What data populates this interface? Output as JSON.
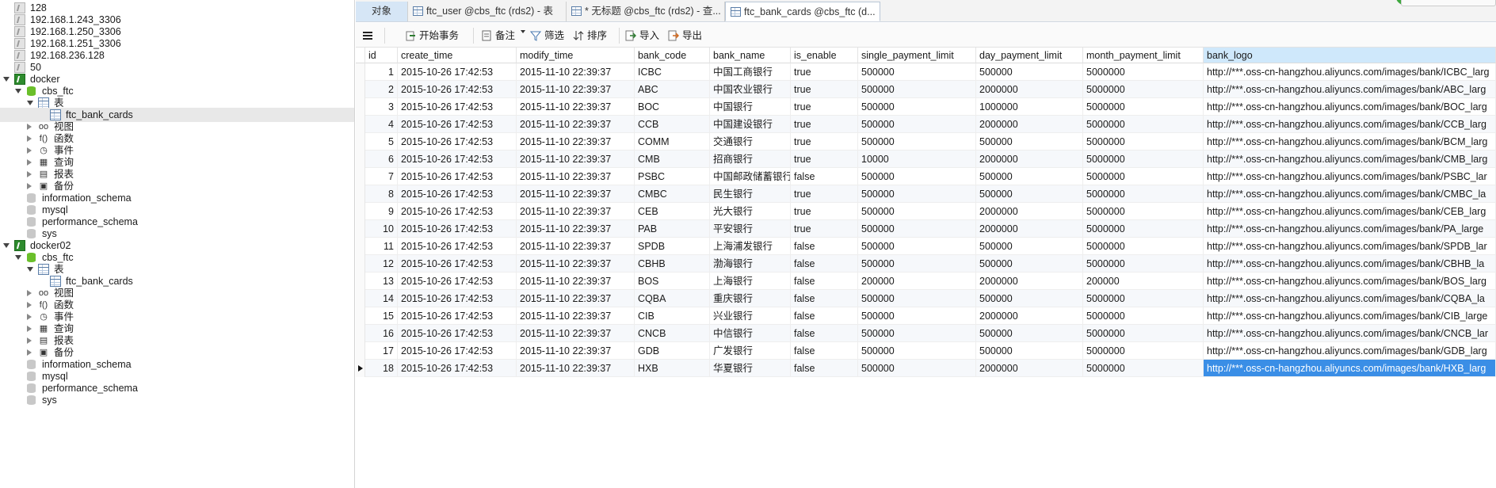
{
  "tree": [
    {
      "label": "128",
      "icon": "connection-gray-icon",
      "depth": 0,
      "tw": "none"
    },
    {
      "label": "192.168.1.243_3306",
      "icon": "connection-gray-icon",
      "depth": 0,
      "tw": "none"
    },
    {
      "label": "192.168.1.250_3306",
      "icon": "connection-gray-icon",
      "depth": 0,
      "tw": "none"
    },
    {
      "label": "192.168.1.251_3306",
      "icon": "connection-gray-icon",
      "depth": 0,
      "tw": "none"
    },
    {
      "label": "192.168.236.128",
      "icon": "connection-gray-icon",
      "depth": 0,
      "tw": "none"
    },
    {
      "label": "50",
      "icon": "connection-gray-icon",
      "depth": 0,
      "tw": "none"
    },
    {
      "label": "docker",
      "icon": "connection-green-icon",
      "depth": 0,
      "tw": "open"
    },
    {
      "label": "cbs_ftc",
      "icon": "database-green-icon",
      "depth": 1,
      "tw": "open"
    },
    {
      "label": "表",
      "icon": "table-group-icon",
      "depth": 2,
      "tw": "open"
    },
    {
      "label": "ftc_bank_cards",
      "icon": "table-icon",
      "depth": 3,
      "tw": "none",
      "selected": true
    },
    {
      "label": "视图",
      "icon": "view-icon",
      "depth": 2,
      "tw": "closed"
    },
    {
      "label": "函数",
      "icon": "function-icon",
      "depth": 2,
      "tw": "closed"
    },
    {
      "label": "事件",
      "icon": "event-icon",
      "depth": 2,
      "tw": "closed"
    },
    {
      "label": "查询",
      "icon": "query-icon",
      "depth": 2,
      "tw": "closed"
    },
    {
      "label": "报表",
      "icon": "report-icon",
      "depth": 2,
      "tw": "closed"
    },
    {
      "label": "备份",
      "icon": "backup-icon",
      "depth": 2,
      "tw": "closed"
    },
    {
      "label": "information_schema",
      "icon": "database-gray-icon",
      "depth": 1,
      "tw": "none"
    },
    {
      "label": "mysql",
      "icon": "database-gray-icon",
      "depth": 1,
      "tw": "none"
    },
    {
      "label": "performance_schema",
      "icon": "database-gray-icon",
      "depth": 1,
      "tw": "none"
    },
    {
      "label": "sys",
      "icon": "database-gray-icon",
      "depth": 1,
      "tw": "none"
    },
    {
      "label": "docker02",
      "icon": "connection-green-icon",
      "depth": 0,
      "tw": "open"
    },
    {
      "label": "cbs_ftc",
      "icon": "database-green-icon",
      "depth": 1,
      "tw": "open"
    },
    {
      "label": "表",
      "icon": "table-group-icon",
      "depth": 2,
      "tw": "open"
    },
    {
      "label": "ftc_bank_cards",
      "icon": "table-icon",
      "depth": 3,
      "tw": "none"
    },
    {
      "label": "视图",
      "icon": "view-icon",
      "depth": 2,
      "tw": "closed"
    },
    {
      "label": "函数",
      "icon": "function-icon",
      "depth": 2,
      "tw": "closed"
    },
    {
      "label": "事件",
      "icon": "event-icon",
      "depth": 2,
      "tw": "closed"
    },
    {
      "label": "查询",
      "icon": "query-icon",
      "depth": 2,
      "tw": "closed"
    },
    {
      "label": "报表",
      "icon": "report-icon",
      "depth": 2,
      "tw": "closed"
    },
    {
      "label": "备份",
      "icon": "backup-icon",
      "depth": 2,
      "tw": "closed"
    },
    {
      "label": "information_schema",
      "icon": "database-gray-icon",
      "depth": 1,
      "tw": "none"
    },
    {
      "label": "mysql",
      "icon": "database-gray-icon",
      "depth": 1,
      "tw": "none"
    },
    {
      "label": "performance_schema",
      "icon": "database-gray-icon",
      "depth": 1,
      "tw": "none"
    },
    {
      "label": "sys",
      "icon": "database-gray-icon",
      "depth": 1,
      "tw": "none"
    }
  ],
  "tabs": [
    {
      "label": "对象",
      "icon": "",
      "active": false
    },
    {
      "label": "ftc_user @cbs_ftc (rds2) - 表",
      "icon": "table-icon",
      "active": false
    },
    {
      "label": "* 无标题 @cbs_ftc (rds2) - 查...",
      "icon": "query-icon",
      "active": false
    },
    {
      "label": "ftc_bank_cards @cbs_ftc (d...",
      "icon": "table-icon",
      "active": true
    }
  ],
  "toolbar": {
    "menu_icon": "hamburger-menu-icon",
    "begin_tx": "开始事务",
    "memo": "备注",
    "filter": "筛选",
    "sort": "排序",
    "import": "导入",
    "export": "导出"
  },
  "grid": {
    "columns": [
      "id",
      "create_time",
      "modify_time",
      "bank_code",
      "bank_name",
      "is_enable",
      "single_payment_limit",
      "day_payment_limit",
      "month_payment_limit",
      "bank_logo"
    ],
    "highlighted_column": "bank_logo",
    "current_row": 18,
    "rows": [
      [
        "1",
        "2015-10-26 17:42:53",
        "2015-11-10 22:39:37",
        "ICBC",
        "中国工商银行",
        "true",
        "500000",
        "500000",
        "5000000",
        "http://***.oss-cn-hangzhou.aliyuncs.com/images/bank/ICBC_larg"
      ],
      [
        "2",
        "2015-10-26 17:42:53",
        "2015-11-10 22:39:37",
        "ABC",
        "中国农业银行",
        "true",
        "500000",
        "2000000",
        "5000000",
        "http://***.oss-cn-hangzhou.aliyuncs.com/images/bank/ABC_larg"
      ],
      [
        "3",
        "2015-10-26 17:42:53",
        "2015-11-10 22:39:37",
        "BOC",
        "中国银行",
        "true",
        "500000",
        "1000000",
        "5000000",
        "http://***.oss-cn-hangzhou.aliyuncs.com/images/bank/BOC_larg"
      ],
      [
        "4",
        "2015-10-26 17:42:53",
        "2015-11-10 22:39:37",
        "CCB",
        "中国建设银行",
        "true",
        "500000",
        "2000000",
        "5000000",
        "http://***.oss-cn-hangzhou.aliyuncs.com/images/bank/CCB_larg"
      ],
      [
        "5",
        "2015-10-26 17:42:53",
        "2015-11-10 22:39:37",
        "COMM",
        "交通银行",
        "true",
        "500000",
        "500000",
        "5000000",
        "http://***.oss-cn-hangzhou.aliyuncs.com/images/bank/BCM_larg"
      ],
      [
        "6",
        "2015-10-26 17:42:53",
        "2015-11-10 22:39:37",
        "CMB",
        "招商银行",
        "true",
        "10000",
        "2000000",
        "5000000",
        "http://***.oss-cn-hangzhou.aliyuncs.com/images/bank/CMB_larg"
      ],
      [
        "7",
        "2015-10-26 17:42:53",
        "2015-11-10 22:39:37",
        "PSBC",
        "中国邮政储蓄银行",
        "false",
        "500000",
        "500000",
        "5000000",
        "http://***.oss-cn-hangzhou.aliyuncs.com/images/bank/PSBC_lar"
      ],
      [
        "8",
        "2015-10-26 17:42:53",
        "2015-11-10 22:39:37",
        "CMBC",
        "民生银行",
        "true",
        "500000",
        "500000",
        "5000000",
        "http://***.oss-cn-hangzhou.aliyuncs.com/images/bank/CMBC_la"
      ],
      [
        "9",
        "2015-10-26 17:42:53",
        "2015-11-10 22:39:37",
        "CEB",
        "光大银行",
        "true",
        "500000",
        "2000000",
        "5000000",
        "http://***.oss-cn-hangzhou.aliyuncs.com/images/bank/CEB_larg"
      ],
      [
        "10",
        "2015-10-26 17:42:53",
        "2015-11-10 22:39:37",
        "PAB",
        "平安银行",
        "true",
        "500000",
        "2000000",
        "5000000",
        "http://***.oss-cn-hangzhou.aliyuncs.com/images/bank/PA_large"
      ],
      [
        "11",
        "2015-10-26 17:42:53",
        "2015-11-10 22:39:37",
        "SPDB",
        "上海浦发银行",
        "false",
        "500000",
        "500000",
        "5000000",
        "http://***.oss-cn-hangzhou.aliyuncs.com/images/bank/SPDB_lar"
      ],
      [
        "12",
        "2015-10-26 17:42:53",
        "2015-11-10 22:39:37",
        "CBHB",
        "渤海银行",
        "false",
        "500000",
        "500000",
        "5000000",
        "http://***.oss-cn-hangzhou.aliyuncs.com/images/bank/CBHB_la"
      ],
      [
        "13",
        "2015-10-26 17:42:53",
        "2015-11-10 22:39:37",
        "BOS",
        "上海银行",
        "false",
        "200000",
        "2000000",
        "200000",
        "http://***.oss-cn-hangzhou.aliyuncs.com/images/bank/BOS_larg"
      ],
      [
        "14",
        "2015-10-26 17:42:53",
        "2015-11-10 22:39:37",
        "CQBA",
        "重庆银行",
        "false",
        "500000",
        "500000",
        "5000000",
        "http://***.oss-cn-hangzhou.aliyuncs.com/images/bank/CQBA_la"
      ],
      [
        "15",
        "2015-10-26 17:42:53",
        "2015-11-10 22:39:37",
        "CIB",
        "兴业银行",
        "false",
        "500000",
        "2000000",
        "5000000",
        "http://***.oss-cn-hangzhou.aliyuncs.com/images/bank/CIB_large"
      ],
      [
        "16",
        "2015-10-26 17:42:53",
        "2015-11-10 22:39:37",
        "CNCB",
        "中信银行",
        "false",
        "500000",
        "500000",
        "5000000",
        "http://***.oss-cn-hangzhou.aliyuncs.com/images/bank/CNCB_lar"
      ],
      [
        "17",
        "2015-10-26 17:42:53",
        "2015-11-10 22:39:37",
        "GDB",
        "广发银行",
        "false",
        "500000",
        "500000",
        "5000000",
        "http://***.oss-cn-hangzhou.aliyuncs.com/images/bank/GDB_larg"
      ],
      [
        "18",
        "2015-10-26 17:42:53",
        "2015-11-10 22:39:37",
        "HXB",
        "华夏银行",
        "false",
        "500000",
        "2000000",
        "5000000",
        "http://***.oss-cn-hangzhou.aliyuncs.com/images/bank/HXB_larg"
      ]
    ]
  },
  "colors": {
    "selection": "#3a8ee6",
    "header_highlight": "#cfe8fb",
    "connection_active": "#2e8b2e",
    "database_active": "#6abf2a"
  }
}
